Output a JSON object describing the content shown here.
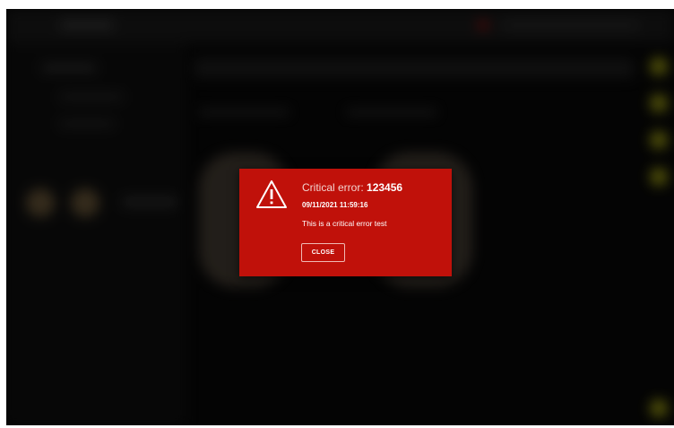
{
  "dialog": {
    "title_prefix": "Critical error: ",
    "error_code": "123456",
    "timestamp": "09/11/2021 11:59:16",
    "message": "This is a critical error test",
    "close_label": "CLOSE",
    "background_color": "#c0110a",
    "icon": "warning-triangle-icon"
  },
  "background": {
    "blurred": true,
    "accent_color": "#8a8a10"
  }
}
